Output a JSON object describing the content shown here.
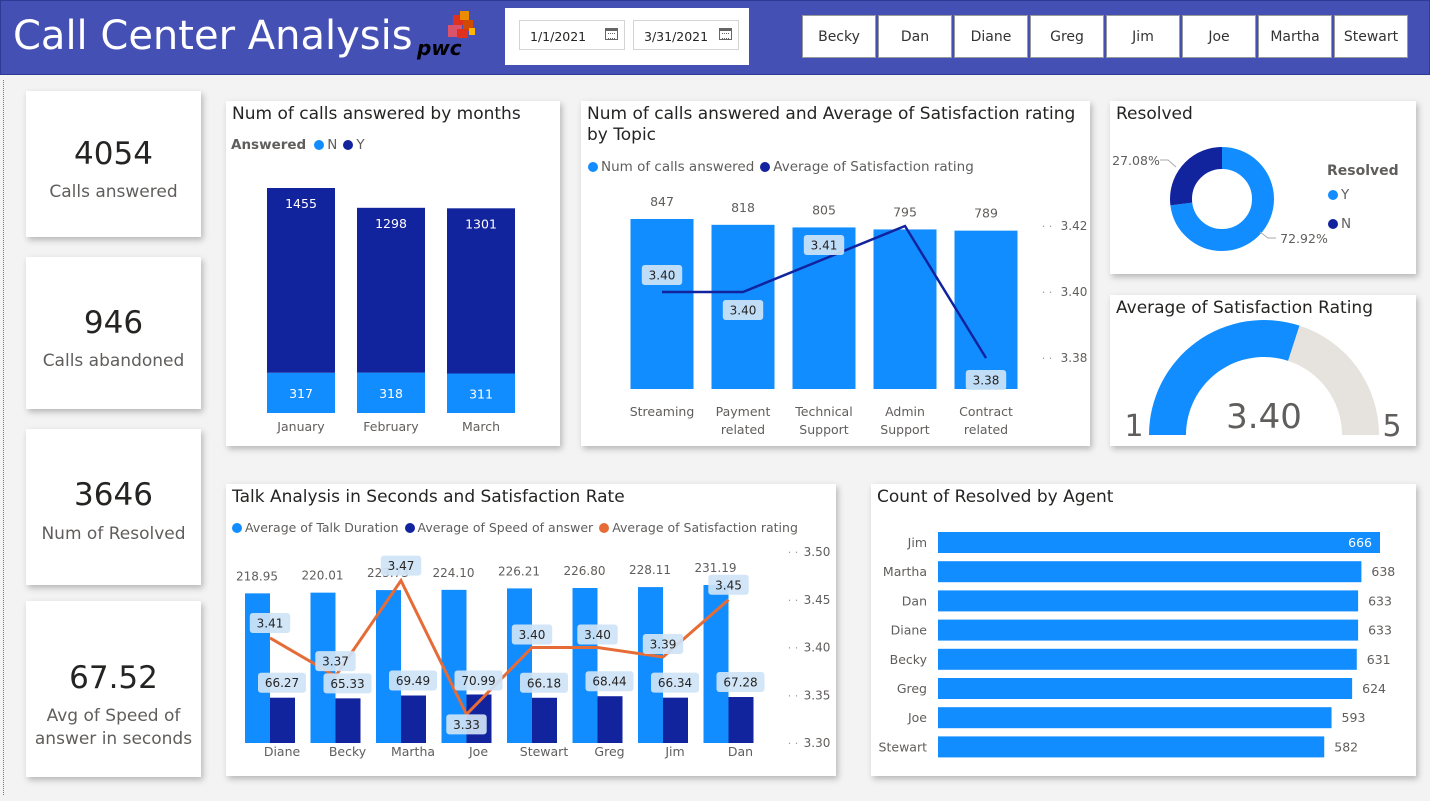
{
  "header": {
    "title": "Call Center Analysis",
    "logo_text": "pwc",
    "date_start": "1/1/2021",
    "date_end": "3/31/2021",
    "agents": [
      "Becky",
      "Dan",
      "Diane",
      "Greg",
      "Jim",
      "Joe",
      "Martha",
      "Stewart"
    ]
  },
  "kpis": [
    {
      "value": "4054",
      "label": "Calls answered"
    },
    {
      "value": "946",
      "label": "Calls abandoned"
    },
    {
      "value": "3646",
      "label": "Num of Resolved"
    },
    {
      "value": "67.52",
      "label_l1": "Avg of Speed of",
      "label_l2": "answer in seconds"
    }
  ],
  "colors": {
    "light": "#118dff",
    "dark": "#12239e",
    "orange": "#e66c37",
    "gauge_bg": "#e6e2dd"
  },
  "months_chart": {
    "title": "Num of calls answered by months",
    "legend_title": "Answered",
    "legend": [
      "N",
      "Y"
    ],
    "chart_data": {
      "type": "bar",
      "categories": [
        "January",
        "February",
        "March"
      ],
      "series": [
        {
          "name": "N",
          "values": [
            317,
            318,
            311
          ]
        },
        {
          "name": "Y",
          "values": [
            1455,
            1298,
            1301
          ]
        }
      ]
    }
  },
  "topic_chart": {
    "title_l1": "Num of calls answered and Average of Satisfaction rating",
    "title_l2": "by Topic",
    "legend": [
      "Num of calls answered",
      "Average of Satisfaction rating"
    ],
    "chart_data": {
      "type": "bar",
      "categories": [
        [
          "Streaming"
        ],
        [
          "Payment",
          "related"
        ],
        [
          "Technical",
          "Support"
        ],
        [
          "Admin",
          "Support"
        ],
        [
          "Contract",
          "related"
        ]
      ],
      "series": [
        {
          "name": "Num of calls answered",
          "values": [
            847,
            818,
            805,
            795,
            789
          ]
        },
        {
          "name": "Average of Satisfaction rating",
          "values": [
            3.4,
            3.4,
            3.41,
            3.42,
            3.38
          ],
          "labels": [
            "3.40",
            "3.40",
            "3.41",
            "",
            "3.38"
          ]
        }
      ],
      "y2_ticks": [
        "3.42",
        "3.40",
        "3.38"
      ]
    }
  },
  "resolved_donut": {
    "title": "Resolved",
    "legend_title": "Resolved",
    "legend": [
      "Y",
      "N"
    ],
    "chart_data": {
      "type": "pie",
      "categories": [
        "Y",
        "N"
      ],
      "values": [
        72.92,
        27.08
      ],
      "labels": [
        "72.92%",
        "27.08%"
      ]
    }
  },
  "gauge": {
    "title": "Average of Satisfaction Rating",
    "value": 3.4,
    "value_label": "3.40",
    "min": 1,
    "max": 5,
    "min_label": "1",
    "max_label": "5"
  },
  "talk_chart": {
    "title": "Talk Analysis in Seconds and Satisfaction Rate",
    "legend": [
      "Average of Talk Duration",
      "Average of Speed of answer",
      "Average of Satisfaction rating"
    ],
    "chart_data": {
      "type": "bar",
      "categories": [
        "Diane",
        "Becky",
        "Martha",
        "Joe",
        "Stewart",
        "Greg",
        "Jim",
        "Dan"
      ],
      "series": [
        {
          "name": "Average of Talk Duration",
          "values": [
            218.95,
            220.01,
            223.73,
            224.1,
            226.21,
            226.8,
            228.11,
            231.19
          ]
        },
        {
          "name": "Average of Speed of answer",
          "values": [
            66.27,
            65.33,
            69.49,
            70.99,
            66.18,
            68.44,
            66.34,
            67.28
          ]
        },
        {
          "name": "Average of Satisfaction rating",
          "values": [
            3.41,
            3.37,
            3.47,
            3.33,
            3.4,
            3.4,
            3.39,
            3.45
          ]
        }
      ],
      "y2_ticks": [
        "3.50",
        "3.45",
        "3.40",
        "3.35",
        "3.30"
      ]
    }
  },
  "agent_chart": {
    "title": "Count of Resolved by Agent",
    "chart_data": {
      "type": "bar",
      "categories": [
        "Jim",
        "Martha",
        "Dan",
        "Diane",
        "Becky",
        "Greg",
        "Joe",
        "Stewart"
      ],
      "values": [
        666,
        638,
        633,
        633,
        631,
        624,
        593,
        582
      ]
    }
  }
}
